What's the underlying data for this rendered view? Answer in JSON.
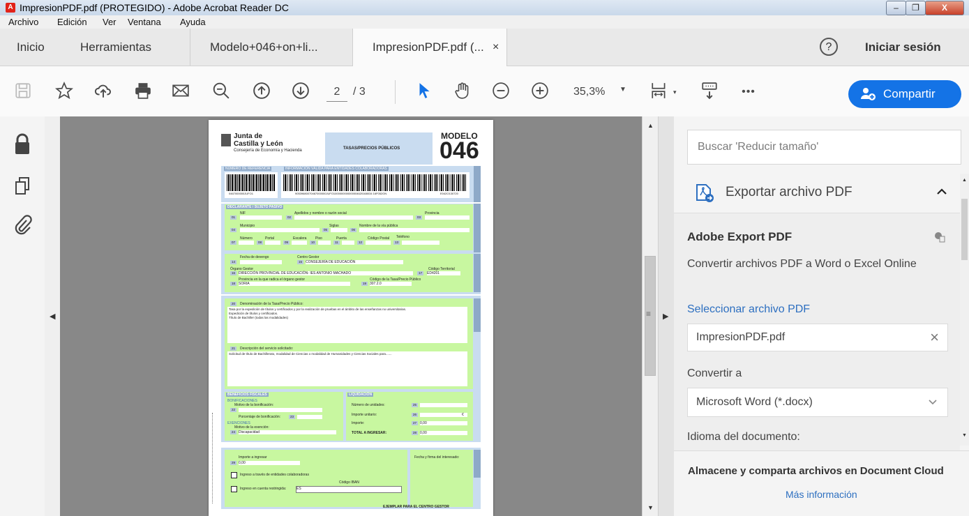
{
  "window": {
    "title": "ImpresionPDF.pdf (PROTEGIDO) - Adobe Acrobat Reader DC",
    "app_icon": "acrobat-icon"
  },
  "menu": [
    "Archivo",
    "Edición",
    "Ver",
    "Ventana",
    "Ayuda"
  ],
  "tabs": {
    "home": "Inicio",
    "tools": "Herramientas",
    "doc1": "Modelo+046+on+li...",
    "doc2": "ImpresionPDF.pdf (...",
    "close": "×",
    "signin": "Iniciar sesión",
    "help": "?"
  },
  "toolbar": {
    "page_current": "2",
    "page_total": "/ 3",
    "zoom": "35,3%",
    "more": "•••",
    "share": "Compartir"
  },
  "form": {
    "logo_line1": "Junta de",
    "logo_line2": "Castilla y León",
    "logo_line3": "Consejería de Economía y Hacienda",
    "header_box": "TASAS/PRECIOS PÚBLICOS",
    "modelo": "MODELO",
    "modelo_num": "046",
    "ref_label": "NÚMERO DE REFERENCIA",
    "info_label": "INFORMACIÓN VÁLIDA PARA ENTIDADES COLABORADORAS",
    "ref_num": "0467000000JUFO1",
    "barcode_num": "90539680070467000000JUFO1000000000000004620168034 16F052GN",
    "barcode_end": "E042O130720",
    "declarante": "DECLARANTE / SUJETO PASIVO",
    "nif": "NIF",
    "apellidos": "Apellidos y nombre o razón social",
    "provincia": "Provincia",
    "municipio": "Municipio",
    "siglas": "Siglas",
    "nombre_via": "Nombre de la vía pública",
    "numero": "Número",
    "portal": "Portal",
    "escalera": "Escalera",
    "piso": "Piso",
    "puerta": "Puerta",
    "codigo_postal": "Código Postal",
    "telefono": "Teléfono",
    "fecha_devengo": "Fecha de devengo",
    "centro_gestor": "Centro Gestor",
    "centro_gestor_val": "CONSEJERÍA DE EDUCACIÓN",
    "organo_gestor": "Órgano Gestor",
    "codigo_territorial": "Código Territorial",
    "organo_val": "DIRECCIÓN PROVINCIAL DE EDUCACIÓN- IES ANTONIO MACHADO",
    "codigo_territorial_val": "ED4201",
    "provincia_organo": "Provincia en la que radica el órgano gestor",
    "codigo_tasa": "Código de la Tasa/Precio Público",
    "provincia_val": "SORIA",
    "codigo_tasa_val": "307.2.0",
    "denominacion": "Denominación de la Tasa/Precio Público:",
    "denominacion_val1": "Tasa por la expedición de títulos y certificados y por la realización de pruebas en el ámbito de las enseñanzas no universitarias.",
    "denominacion_val2": "Expedición de títulos y certificados.",
    "denominacion_val3": "Título de Bachiller (todas las modalidades)",
    "descripcion": "Descripción del servicio solicitado:",
    "descripcion_val": "Solicitud de título de Bachillerato, modalidad de Ciencias o modalidad de Humanidades y Ciencias Sociales para.......",
    "beneficios": "BENEFICIOS FISCALES",
    "bonificaciones": "BONIFICACIONES",
    "motivo_bonif": "Motivo de la bonificación:",
    "porcentaje": "Porcentaje de bonificación:",
    "exenciones": "EXENCIONES",
    "motivo_exencion": "Motivo de la exención:",
    "exencion_val": "Discapacidad",
    "liquidacion": "LIQUIDACIÓN",
    "num_unidades": "Número de unidades:",
    "importe_unitario": "Importe unitario:",
    "importe": "Importe:",
    "importe_val": "0,00",
    "total": "TOTAL A INGRESAR:",
    "total_val": "0,00",
    "euro": "€",
    "importe_ingresar": "Importe a ingresar",
    "importe_ingresar_val": "0,00",
    "ingreso_entidades": "Ingreso a través de entidades colaboradoras",
    "codigo_iban": "Código IBAN",
    "ingreso_cuenta": "Ingreso en cuenta restringida:",
    "iban_prefix": "ES",
    "firma": "Fecha y firma del interesado:",
    "ejemplar": "EJEMPLAR PARA EL CENTRO GESTOR",
    "side_ref": "REFERENCIA",
    "side_ident": "IDENTIFICACIÓN",
    "side_datos": "DATOS",
    "side_liq": "LIQUIDACIÓN",
    "side_ingreso": "INGRESO",
    "field_nums": {
      "n01": "01",
      "n02": "02",
      "n03": "03",
      "n04": "04",
      "n05": "05",
      "n06": "06",
      "n07": "07",
      "n08": "08",
      "n09": "09",
      "n10": "10",
      "n11": "11",
      "n12": "12",
      "n13": "13",
      "n14": "14",
      "n15": "15",
      "n16": "16",
      "n17": "17",
      "n18": "18",
      "n19": "19",
      "n20": "20",
      "n21": "21",
      "n22": "22",
      "n23": "23",
      "n24": "24",
      "n25": "25",
      "n26": "26",
      "n27": "27",
      "n28": "28",
      "n29": "29"
    }
  },
  "right_panel": {
    "search_placeholder": "Buscar 'Reducir tamaño'",
    "export_title": "Exportar archivo PDF",
    "adobe_export": "Adobe Export PDF",
    "convert_desc": "Convertir archivos PDF a Word o Excel Online",
    "select_link": "Seleccionar archivo PDF",
    "file_name": "ImpresionPDF.pdf",
    "file_clear": "×",
    "convert_to_label": "Convertir a",
    "convert_to_value": "Microsoft Word (*.docx)",
    "language_label": "Idioma del documento:",
    "cloud_text": "Almacene y comparta archivos en Document Cloud",
    "more_info": "Más información"
  },
  "colors": {
    "accent": "#1473e6",
    "form_green": "#c8f7a0",
    "form_blue": "#c9dcf0",
    "close_red": "#c8412a"
  }
}
